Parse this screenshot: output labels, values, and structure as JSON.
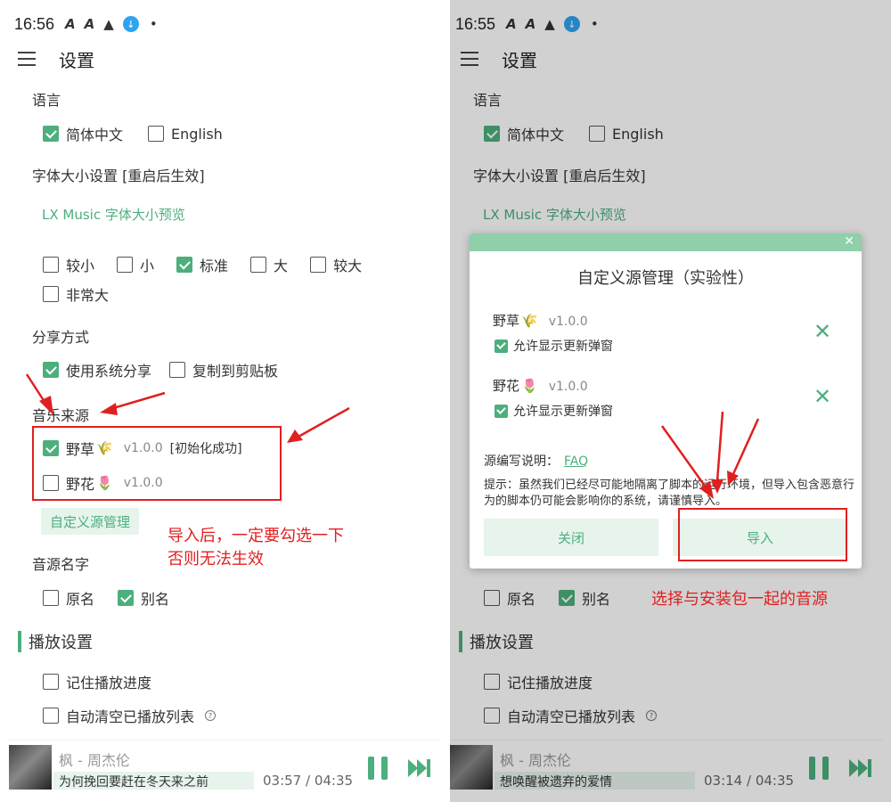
{
  "left": {
    "status_time": "16:56",
    "app_title": "设置",
    "language": {
      "label": "语言",
      "options": [
        "简体中文",
        "English"
      ]
    },
    "font_size": {
      "label": "字体大小设置 [重启后生效]",
      "preview": "LX Music 字体大小预览",
      "options": [
        "较小",
        "小",
        "标准",
        "大",
        "较大",
        "非常大"
      ]
    },
    "share": {
      "label": "分享方式",
      "options": [
        "使用系统分享",
        "复制到剪贴板"
      ]
    },
    "music_source": {
      "label": "音乐来源",
      "sources": [
        {
          "name": "野草",
          "emoji": "🌾",
          "version": "v1.0.0",
          "status": "[初始化成功]"
        },
        {
          "name": "野花",
          "emoji": "🌷",
          "version": "v1.0.0"
        }
      ],
      "manage_button": "自定义源管理"
    },
    "source_name": {
      "label": "音源名字",
      "options": [
        "原名",
        "别名"
      ]
    },
    "playback": {
      "section": "播放设置",
      "options": [
        "记住播放进度",
        "自动清空已播放列表"
      ]
    },
    "player": {
      "song": "枫 - 周杰伦",
      "lyric": "为何挽回要赶在冬天来之前",
      "time": "03:57 / 04:35"
    },
    "annotation": "导入后，一定要勾选一下\n否则无法生效"
  },
  "right": {
    "status_time": "16:55",
    "app_title": "设置",
    "language": {
      "label": "语言",
      "options": [
        "简体中文",
        "English"
      ]
    },
    "font_size": {
      "label": "字体大小设置 [重启后生效]",
      "preview": "LX Music 字体大小预览"
    },
    "source_name": {
      "options": [
        "原名",
        "别名"
      ]
    },
    "playback": {
      "section": "播放设置",
      "options": [
        "记住播放进度",
        "自动清空已播放列表"
      ]
    },
    "player": {
      "song": "枫 - 周杰伦",
      "lyric": "想唤醒被遗弃的爱情",
      "time": "03:14 / 04:35"
    },
    "dialog": {
      "title": "自定义源管理（实验性）",
      "sources": [
        {
          "name": "野草",
          "emoji": "🌾",
          "version": "v1.0.0",
          "option": "允许显示更新弹窗"
        },
        {
          "name": "野花",
          "emoji": "🌷",
          "version": "v1.0.0",
          "option": "允许显示更新弹窗"
        }
      ],
      "faq_label": "源编写说明：",
      "faq_link": "FAQ",
      "tip": "提示：虽然我们已经尽可能地隔离了脚本的运行环境，但导入包含恶意行为的脚本仍可能会影响你的系统，请谨慎导入。",
      "close_button": "关闭",
      "import_button": "导入"
    },
    "annotation": "选择与安装包一起的音源"
  },
  "colors": {
    "accent": "#4caf7d",
    "annotation": "#e02020"
  }
}
